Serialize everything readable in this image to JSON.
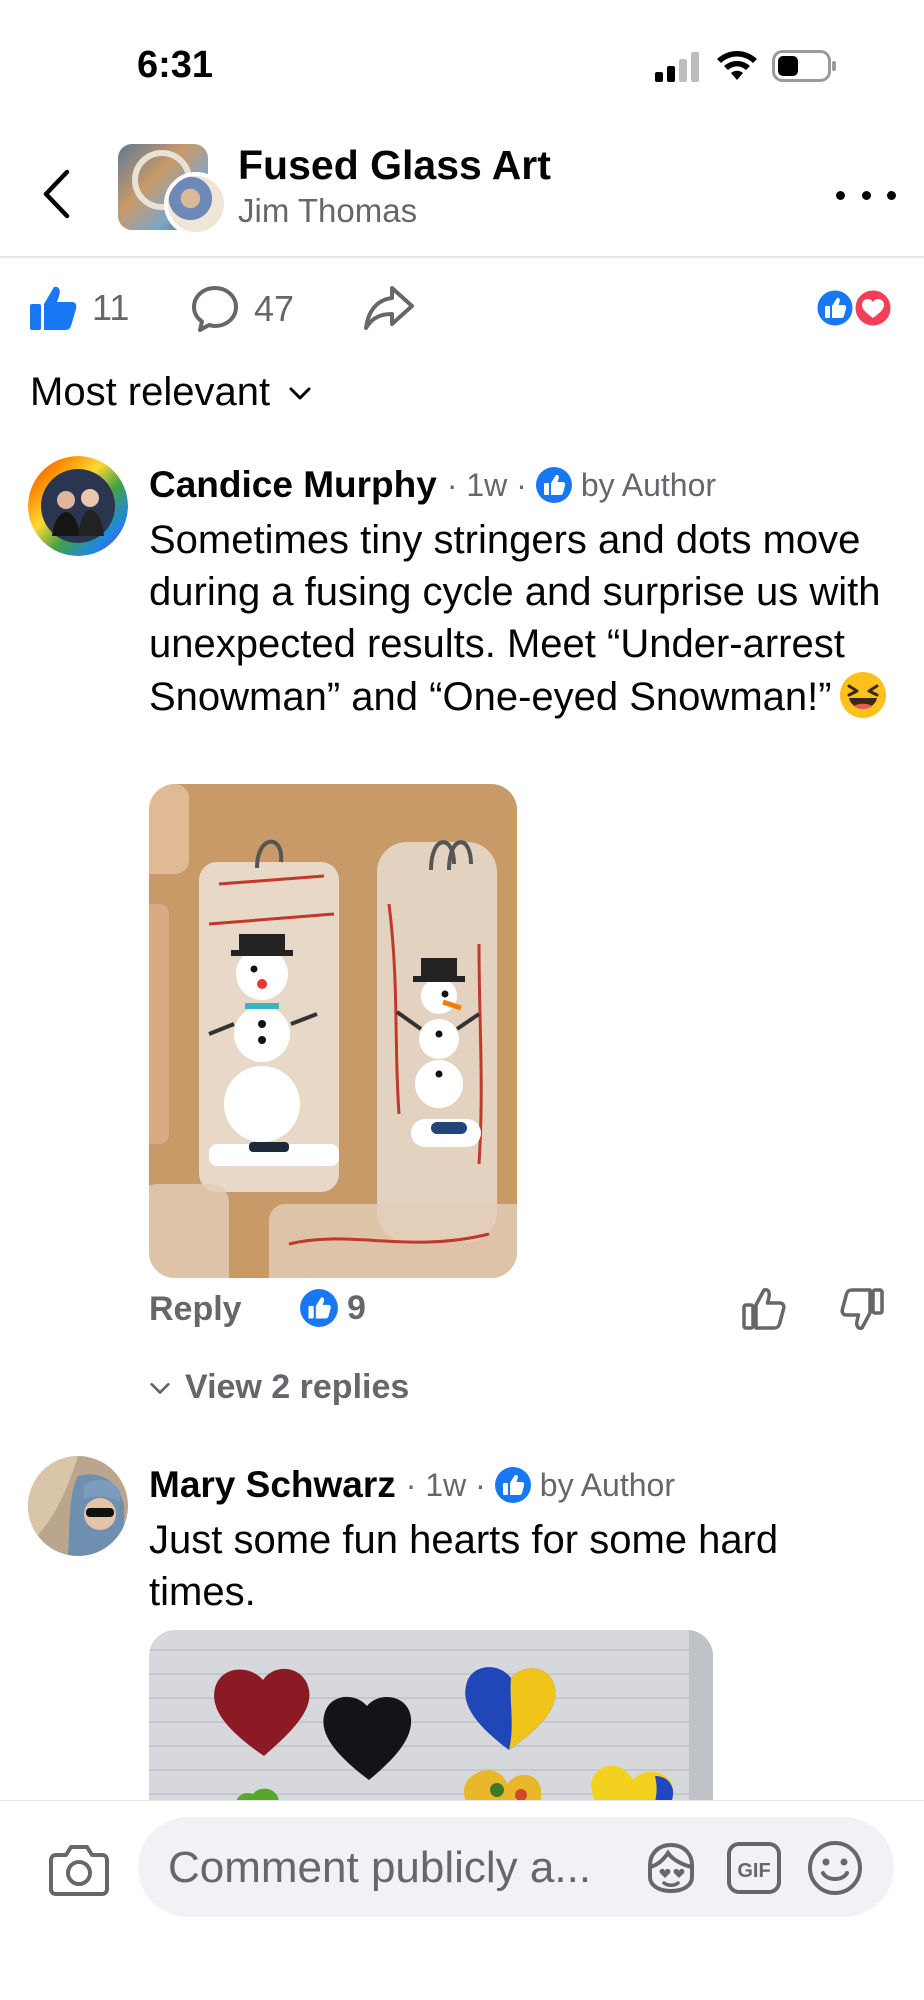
{
  "status_bar": {
    "time": "6:31"
  },
  "header": {
    "title": "Fused Glass Art",
    "subtitle": "Jim Thomas"
  },
  "reactions": {
    "like_count": "11",
    "comment_count": "47"
  },
  "sort": {
    "label": "Most relevant"
  },
  "comments": [
    {
      "author": "Candice Murphy",
      "time": "· 1w ·",
      "badge": "by Author",
      "text": "Sometimes tiny stringers and dots move during a fusing cycle and surprise us with unexpected results. Meet “Under-arrest Snowman” and “One-eyed Snowman!”",
      "emoji": "laughing-squint-emoji",
      "reply_label": "Reply",
      "like_count": "9",
      "view_replies": "View 2 replies"
    },
    {
      "author": "Mary Schwarz",
      "time": "· 1w ·",
      "badge": "by Author",
      "text": "Just some fun hearts for some hard times."
    }
  ],
  "composer": {
    "placeholder": "Comment publicly a..."
  },
  "colors": {
    "accent": "#1877f2",
    "love": "#f33e58",
    "muted": "#65676b"
  }
}
